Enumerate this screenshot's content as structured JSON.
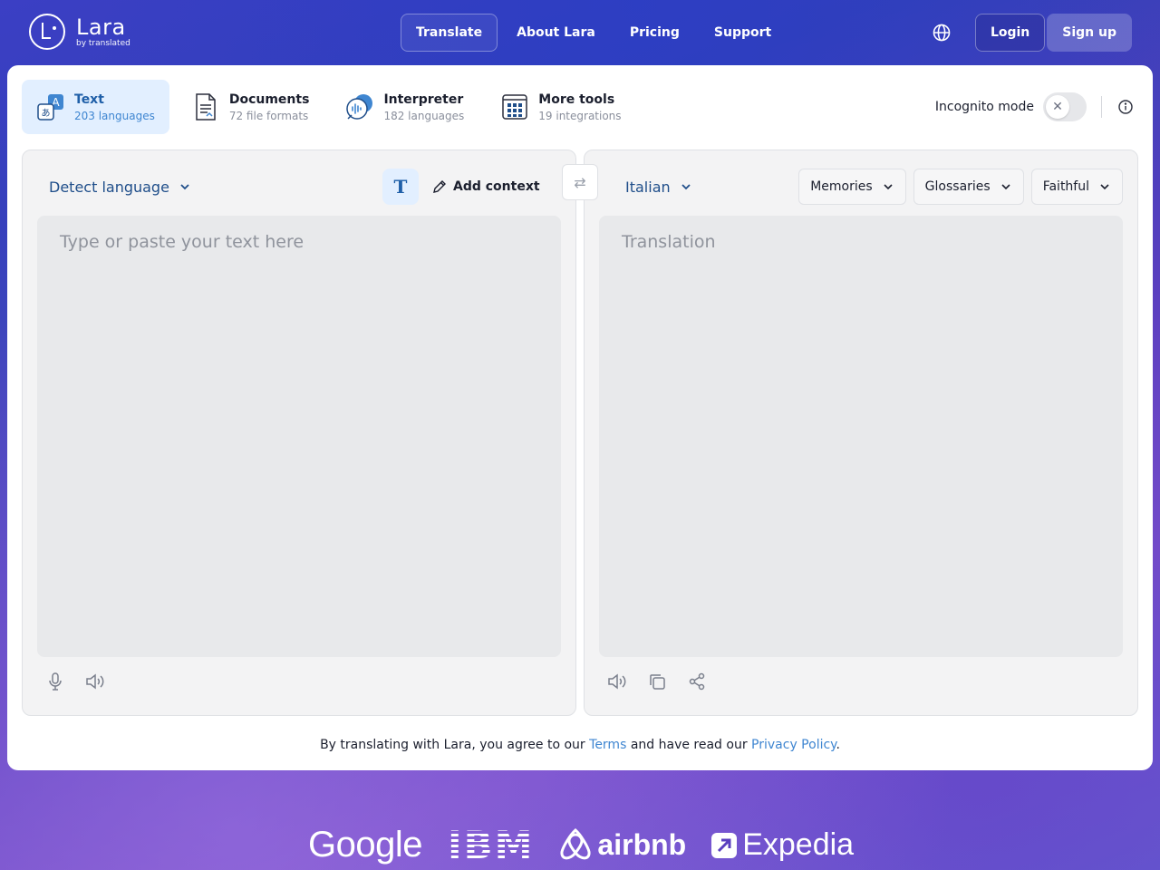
{
  "brand": {
    "name": "Lara",
    "sub": "by translated"
  },
  "nav": {
    "items": [
      {
        "label": "Translate",
        "active": true
      },
      {
        "label": "About Lara",
        "active": false
      },
      {
        "label": "Pricing",
        "active": false
      },
      {
        "label": "Support",
        "active": false
      }
    ],
    "login": "Login",
    "signup": "Sign up"
  },
  "modes": [
    {
      "title": "Text",
      "sub": "203 languages",
      "active": true,
      "icon": "text-translate-icon"
    },
    {
      "title": "Documents",
      "sub": "72 file formats",
      "active": false,
      "icon": "document-icon"
    },
    {
      "title": "Interpreter",
      "sub": "182 languages",
      "active": false,
      "icon": "interpreter-icon"
    },
    {
      "title": "More tools",
      "sub": "19 integrations",
      "active": false,
      "icon": "grid-icon"
    }
  ],
  "incognito": {
    "label": "Incognito mode",
    "enabled": false
  },
  "source": {
    "language": "Detect language",
    "placeholder": "Type or paste your text here",
    "add_context": "Add context",
    "style_button": "T"
  },
  "target": {
    "language": "Italian",
    "placeholder": "Translation",
    "memories": "Memories",
    "glossaries": "Glossaries",
    "mode": "Faithful"
  },
  "terms": {
    "prefix": "By translating with Lara, you agree to our ",
    "terms_link": "Terms",
    "middle": " and have read our ",
    "privacy_link": "Privacy Policy",
    "suffix": "."
  },
  "brands": [
    "Google",
    "IBM",
    "airbnb",
    "Expedia"
  ],
  "colors": {
    "accent": "#1f5fa8",
    "link": "#3f86d1",
    "active_bg": "#e2efff"
  }
}
